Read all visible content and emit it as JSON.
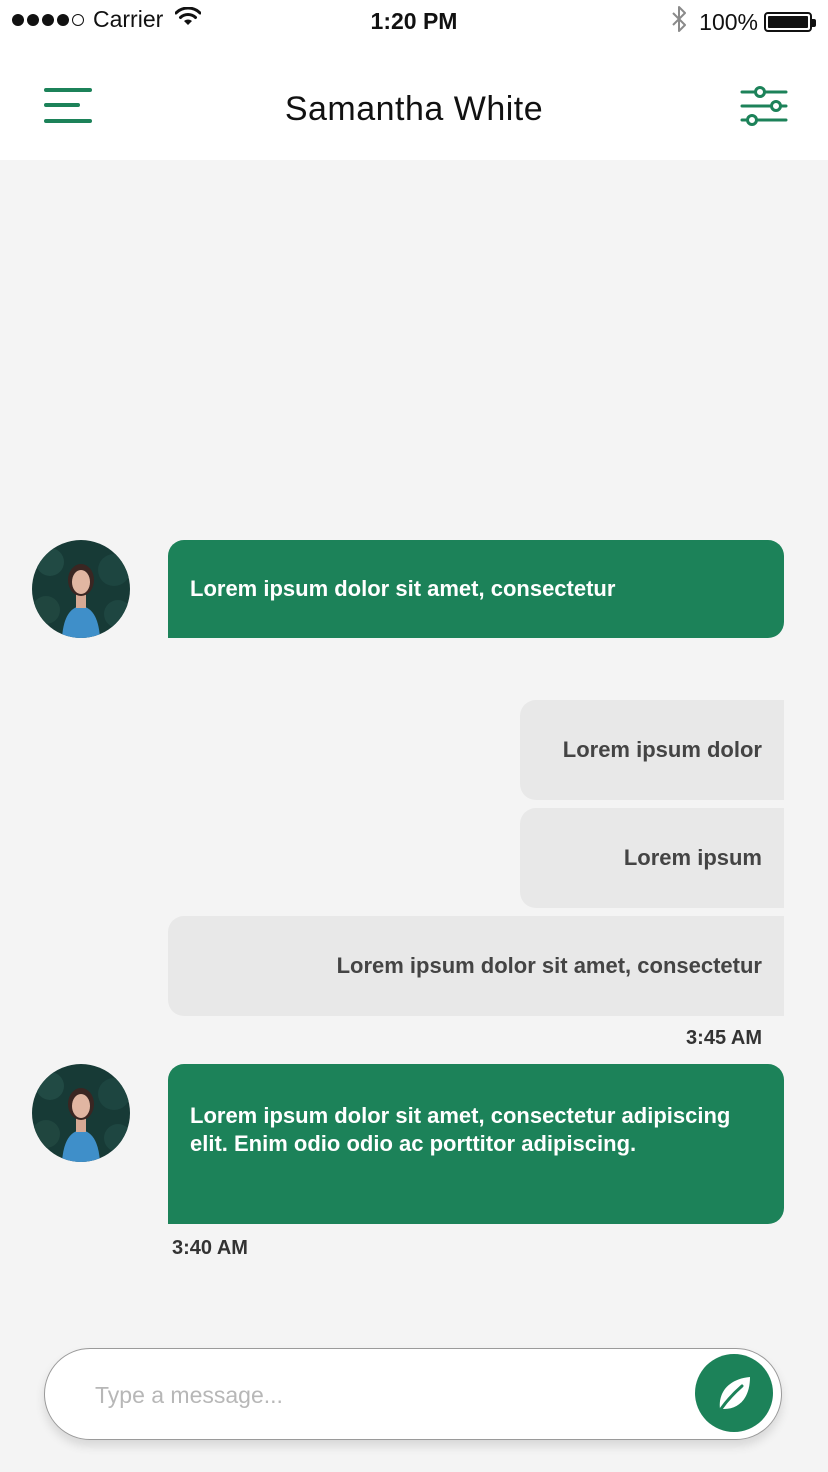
{
  "status_bar": {
    "carrier": "Carrier",
    "time": "1:20 PM",
    "battery": "100%",
    "battery_level": 1.0,
    "signal_bars_filled": 4,
    "signal_bars_total": 5
  },
  "header": {
    "title": "Samantha White",
    "menu_icon": "hamburger-menu-icon",
    "filter_icon": "sliders-icon"
  },
  "colors": {
    "accent": "#1c8259",
    "incoming_bubble": "#1c8259",
    "outgoing_bubble": "#e8e8e8",
    "background": "#f4f4f4"
  },
  "messages": [
    {
      "direction": "incoming",
      "text": "Lorem ipsum dolor sit amet, consectetur",
      "timestamp": ""
    },
    {
      "direction": "outgoing",
      "text": "Lorem ipsum dolor",
      "timestamp": ""
    },
    {
      "direction": "outgoing",
      "text": "Lorem ipsum",
      "timestamp": ""
    },
    {
      "direction": "outgoing",
      "text": "Lorem ipsum dolor sit amet, consectetur",
      "timestamp": "3:45 AM"
    },
    {
      "direction": "incoming",
      "text": "Lorem ipsum dolor sit amet, consectetur adipiscing elit. Enim odio odio ac porttitor adipiscing.",
      "timestamp": "3:40 AM"
    }
  ],
  "composer": {
    "placeholder": "Type a message...",
    "value": "",
    "send_icon": "leaf-icon"
  }
}
